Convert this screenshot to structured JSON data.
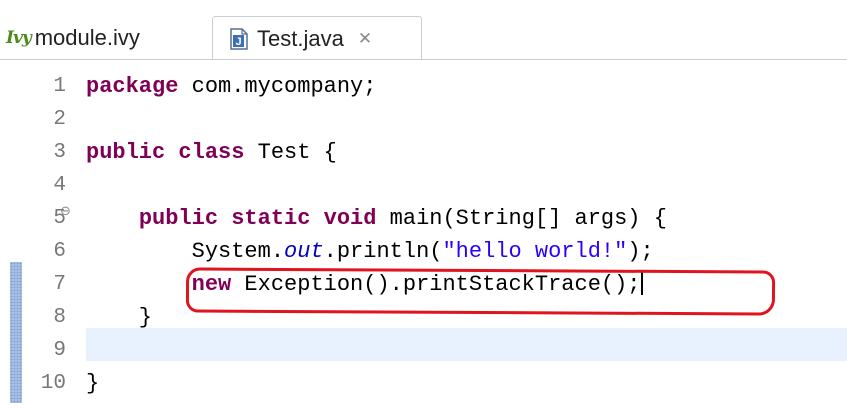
{
  "tabs": [
    {
      "icon": "ivy-icon",
      "icon_text": "Ivy",
      "label": "module.ivy",
      "active": false
    },
    {
      "icon": "java-file-icon",
      "icon_text": "J",
      "label": "Test.java",
      "close_glyph": "✕",
      "active": true
    }
  ],
  "editor": {
    "lines": [
      {
        "number": "1",
        "text": "package com.mycompany;"
      },
      {
        "number": "2",
        "text": ""
      },
      {
        "number": "3",
        "text": "public class Test {"
      },
      {
        "number": "4",
        "text": ""
      },
      {
        "number": "5",
        "text": "public static void main(String[] args) {",
        "fold": "⊖"
      },
      {
        "number": "6",
        "text": "System.out.println(\"hello world!\");"
      },
      {
        "number": "7",
        "text": "new Exception().printStackTrace();"
      },
      {
        "number": "8",
        "text": "}"
      },
      {
        "number": "9",
        "text": ""
      },
      {
        "number": "10",
        "text": "}"
      }
    ],
    "current_line": 7
  },
  "colors": {
    "keyword": "#7f0055",
    "string": "#2a00ff",
    "field": "#0000c0",
    "current_line_bg": "#e8f2fe",
    "annotation_red": "#e0141e"
  }
}
